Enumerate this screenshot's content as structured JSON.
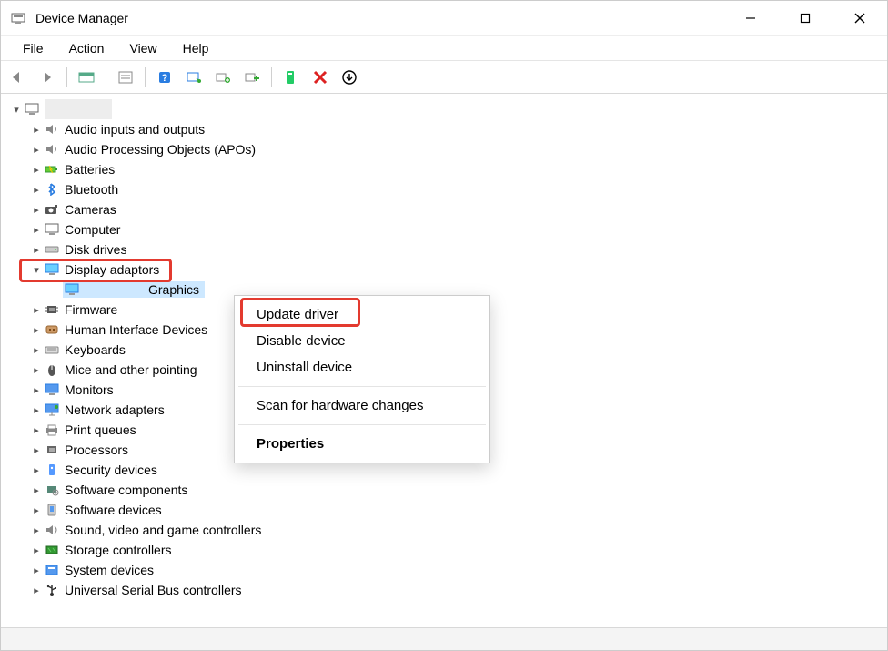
{
  "window": {
    "title": "Device Manager"
  },
  "menu": {
    "file": "File",
    "action": "Action",
    "view": "View",
    "help": "Help"
  },
  "tree": {
    "root_name": "",
    "categories": [
      {
        "label": "Audio inputs and outputs",
        "icon": "speaker"
      },
      {
        "label": "Audio Processing Objects (APOs)",
        "icon": "speaker"
      },
      {
        "label": "Batteries",
        "icon": "battery"
      },
      {
        "label": "Bluetooth",
        "icon": "bluetooth"
      },
      {
        "label": "Cameras",
        "icon": "camera"
      },
      {
        "label": "Computer",
        "icon": "computer"
      },
      {
        "label": "Disk drives",
        "icon": "disk"
      },
      {
        "label": "Display adaptors",
        "icon": "display",
        "expanded": true
      },
      {
        "label": "Firmware",
        "icon": "chip"
      },
      {
        "label": "Human Interface Devices",
        "icon": "hid"
      },
      {
        "label": "Keyboards",
        "icon": "keyboard"
      },
      {
        "label": "Mice and other pointing",
        "icon": "mouse",
        "truncated": true
      },
      {
        "label": "Monitors",
        "icon": "monitor"
      },
      {
        "label": "Network adapters",
        "icon": "network"
      },
      {
        "label": "Print queues",
        "icon": "printer"
      },
      {
        "label": "Processors",
        "icon": "cpu"
      },
      {
        "label": "Security devices",
        "icon": "security"
      },
      {
        "label": "Software components",
        "icon": "softcomp"
      },
      {
        "label": "Software devices",
        "icon": "softdev"
      },
      {
        "label": "Sound, video and game controllers",
        "icon": "sound"
      },
      {
        "label": "Storage controllers",
        "icon": "storage"
      },
      {
        "label": "System devices",
        "icon": "system"
      },
      {
        "label": "Universal Serial Bus controllers",
        "icon": "usb"
      }
    ],
    "display_child_label": "Graphics",
    "display_child_prefix_hidden": true
  },
  "context_menu": {
    "items": [
      {
        "label": "Update driver",
        "highlight": true
      },
      {
        "label": "Disable device"
      },
      {
        "label": "Uninstall device"
      },
      {
        "sep": true
      },
      {
        "label": "Scan for hardware changes"
      },
      {
        "sep": true
      },
      {
        "label": "Properties",
        "bold": true
      }
    ]
  }
}
